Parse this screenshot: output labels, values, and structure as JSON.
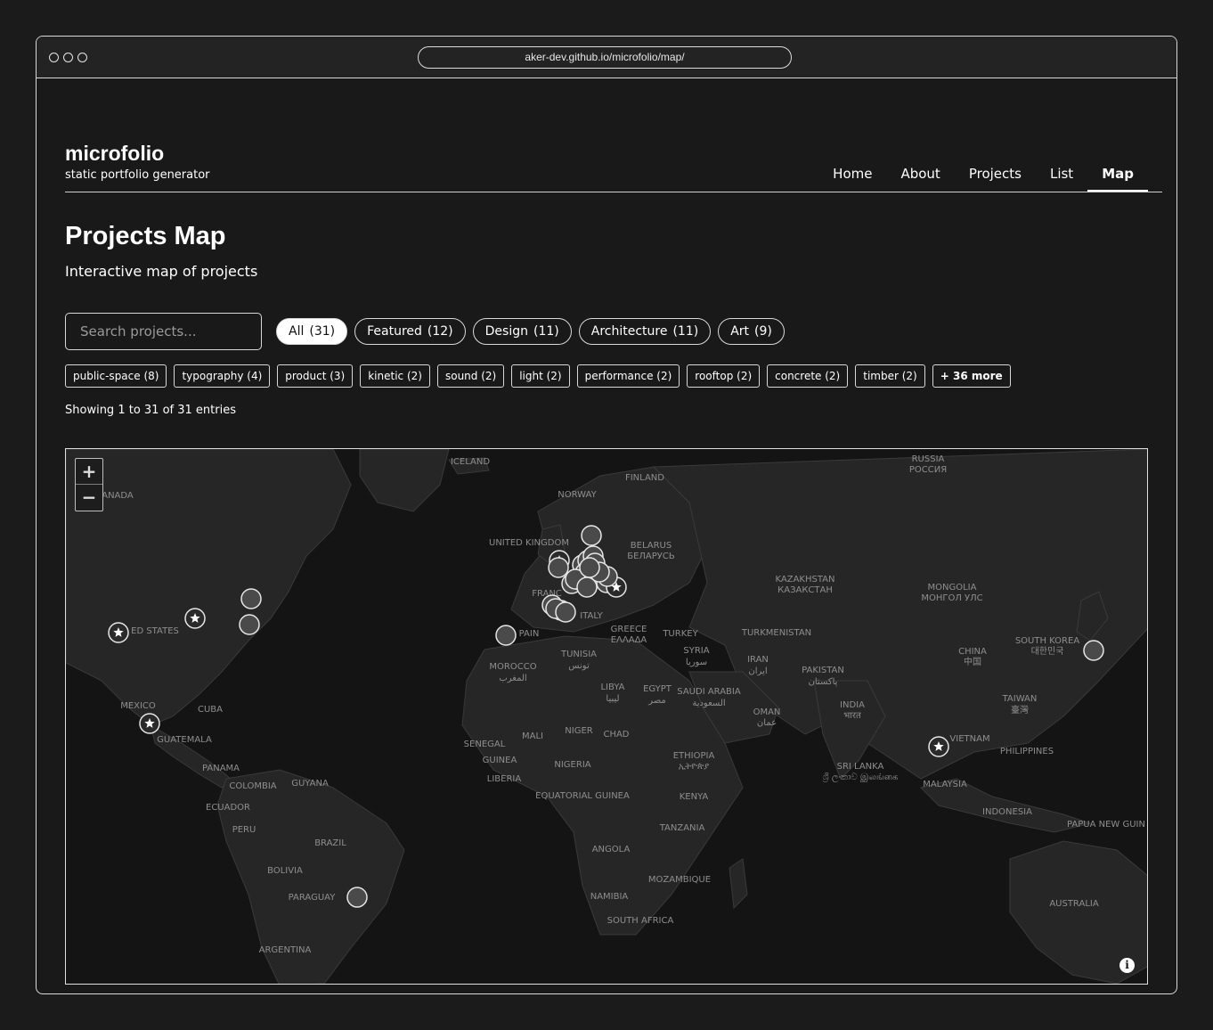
{
  "browser": {
    "url": "aker-dev.github.io/microfolio/map/"
  },
  "site": {
    "title": "microfolio",
    "tagline": "static portfolio generator"
  },
  "nav": {
    "items": [
      {
        "label": "Home"
      },
      {
        "label": "About"
      },
      {
        "label": "Projects"
      },
      {
        "label": "List"
      },
      {
        "label": "Map",
        "active": true
      }
    ]
  },
  "page": {
    "title": "Projects Map",
    "subtitle": "Interactive map of projects"
  },
  "search": {
    "placeholder": "Search projects..."
  },
  "categories": [
    {
      "label": "All",
      "count": "(31)",
      "active": true
    },
    {
      "label": "Featured",
      "count": "(12)"
    },
    {
      "label": "Design",
      "count": "(11)"
    },
    {
      "label": "Architecture",
      "count": "(11)"
    },
    {
      "label": "Art",
      "count": "(9)"
    }
  ],
  "tags": [
    {
      "label": "public-space (8)"
    },
    {
      "label": "typography (4)"
    },
    {
      "label": "product (3)"
    },
    {
      "label": "kinetic (2)"
    },
    {
      "label": "sound (2)"
    },
    {
      "label": "light (2)"
    },
    {
      "label": "performance (2)"
    },
    {
      "label": "rooftop (2)"
    },
    {
      "label": "concrete (2)"
    },
    {
      "label": "timber (2)"
    }
  ],
  "tags_more": "+ 36 more",
  "entries_text": "Showing 1 to 31 of 31 entries",
  "map": {
    "zoom_in": "+",
    "zoom_out": "−",
    "info": "i",
    "labels": [
      "ICELAND",
      "FINLAND",
      "NORWAY",
      "RUSSIA",
      "РОССИЯ",
      "UNITED KINGDOM",
      "BELARUS",
      "БЕЛАРУСЬ",
      "ANADA",
      "KAZAKHSTAN",
      "КАЗАКСТАН",
      "MONGOLIA",
      "МОНГОЛ УЛС",
      "FRANC",
      "ITALY",
      "ED STATES",
      "PAIN",
      "GREECE",
      "ΕΛΛΑΔΑ",
      "TURKEY",
      "TURKMENISTAN",
      "SOUTH KOREA",
      "대한민국",
      "CHINA",
      "中国",
      "MOROCCO",
      "المغرب",
      "TUNISIA",
      "تونس",
      "SYRIA",
      "سوريا",
      "IRAN",
      "ایران",
      "PAKISTAN",
      "پاکستان",
      "LIBYA",
      "ليبيا",
      "EGYPT",
      "مصر",
      "SAUDI ARABIA",
      "السعودية",
      "OMAN",
      "عمان",
      "INDIA",
      "भारत",
      "TAIWAN",
      "臺灣",
      "MEXICO",
      "CUBA",
      "GUATEMALA",
      "SENEGAL",
      "MALI",
      "NIGER",
      "CHAD",
      "VIETNAM",
      "PHILIPPINES",
      "GUINEA",
      "NIGERIA",
      "ETHIOPIA",
      "ኢትዮጵያ",
      "SRI LANKA",
      "ශ්‍රී ලංකාව இலங்கை",
      "LIBERIA",
      "MALAYSIA",
      "PANAMA",
      "COLOMBIA",
      "GUYANA",
      "EQUATORIAL GUINEA",
      "KENYA",
      "ECUADOR",
      "INDONESIA",
      "PAPUA NEW GUIN",
      "PERU",
      "BRAZIL",
      "TANZANIA",
      "ANGOLA",
      "BOLIVIA",
      "MOZAMBIQUE",
      "PARAGUAY",
      "NAMIBIA",
      "SOUTH AFRICA",
      "AUSTRALIA",
      "ARGENTINA"
    ]
  }
}
